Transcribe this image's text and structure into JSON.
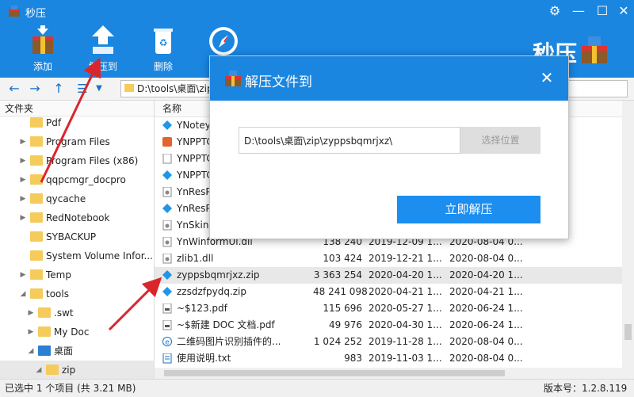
{
  "app": {
    "title": "秒压",
    "brand": "秒压"
  },
  "toolbar": {
    "items": [
      {
        "label": "添加"
      },
      {
        "label": "解压到"
      },
      {
        "label": "删除"
      }
    ]
  },
  "nav": {
    "path": "D:\\tools\\桌面\\zip"
  },
  "tree": {
    "header": "文件夹",
    "items": [
      {
        "label": "Pdf"
      },
      {
        "label": "Program Files"
      },
      {
        "label": "Program Files (x86)"
      },
      {
        "label": "qqpcmgr_docpro"
      },
      {
        "label": "qycache"
      },
      {
        "label": "RedNotebook"
      },
      {
        "label": "SYBACKUP"
      },
      {
        "label": "System Volume Infor..."
      },
      {
        "label": "Temp"
      },
      {
        "label": "tools"
      },
      {
        "label": ".swt"
      },
      {
        "label": "My Doc"
      },
      {
        "label": "桌面"
      },
      {
        "label": "zip"
      }
    ]
  },
  "list": {
    "header_name": "名称",
    "rows": [
      {
        "name": "YNoteyc",
        "size": "",
        "d1": "",
        "d2": ""
      },
      {
        "name": "YNPPTC",
        "size": "",
        "d1": "",
        "d2": ""
      },
      {
        "name": "YNPPTC",
        "size": "",
        "d1": "",
        "d2": ""
      },
      {
        "name": "YNPPTC",
        "size": "",
        "d1": "",
        "d2": ""
      },
      {
        "name": "YnResPr",
        "size": "",
        "d1": "",
        "d2": ""
      },
      {
        "name": "YnResPr",
        "size": "",
        "d1": "",
        "d2": ""
      },
      {
        "name": "YnSkin.c",
        "size": "",
        "d1": "",
        "d2": ""
      },
      {
        "name": "YnWinformUi.dll",
        "size": "138 240",
        "d1": "2019-12-09 1...",
        "d2": "2020-08-04 0..."
      },
      {
        "name": "zlib1.dll",
        "size": "103 424",
        "d1": "2019-12-21 1...",
        "d2": "2020-08-04 0..."
      },
      {
        "name": "zyppsbqmrjxz.zip",
        "size": "3 363 254",
        "d1": "2020-04-20 1...",
        "d2": "2020-04-20 1..."
      },
      {
        "name": "zzsdzfpydq.zip",
        "size": "48 241 098",
        "d1": "2020-04-21 1...",
        "d2": "2020-04-21 1..."
      },
      {
        "name": "~$123.pdf",
        "size": "115 696",
        "d1": "2020-05-27 1...",
        "d2": "2020-06-24 1..."
      },
      {
        "name": "~$新建 DOC 文档.pdf",
        "size": "49 976",
        "d1": "2020-04-30 1...",
        "d2": "2020-06-24 1..."
      },
      {
        "name": "二维码图片识别插件的...",
        "size": "1 024 252",
        "d1": "2019-11-28 1...",
        "d2": "2020-08-04 0..."
      },
      {
        "name": "使用说明.txt",
        "size": "983",
        "d1": "2019-11-03 1...",
        "d2": "2020-08-04 0..."
      }
    ]
  },
  "status": {
    "left": "已选中 1 个项目 (共 3.21 MB)",
    "right": "版本号：1.2.8.119"
  },
  "dialog": {
    "title": "解压文件到",
    "dest_value": "D:\\tools\\桌面\\zip\\zyppsbqmrjxz\\",
    "choose_label": "选择位置",
    "extract_label": "立即解压"
  },
  "colors": {
    "accent": "#1a86e0",
    "button": "#1b8ef0",
    "arrow": "#d9262b"
  }
}
